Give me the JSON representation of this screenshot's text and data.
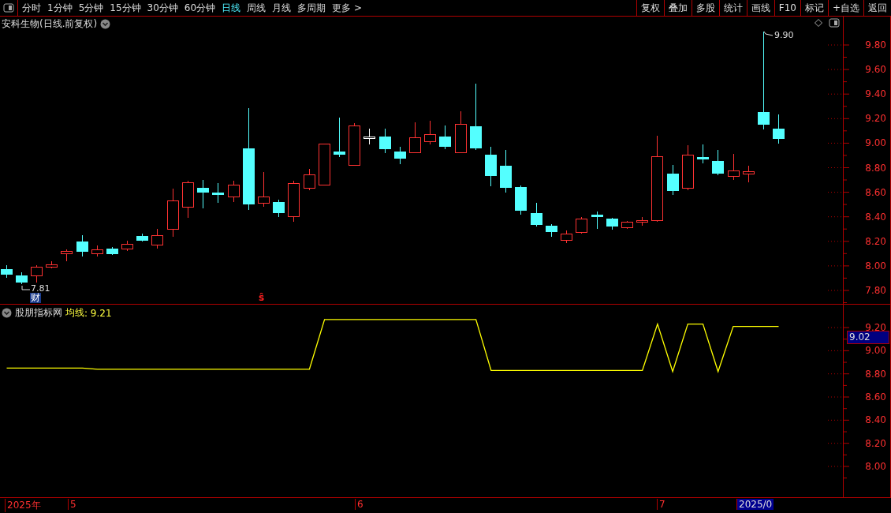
{
  "toolbar": {
    "tabs": [
      {
        "label": "分时",
        "selected": false
      },
      {
        "label": "1分钟",
        "selected": false
      },
      {
        "label": "5分钟",
        "selected": false
      },
      {
        "label": "15分钟",
        "selected": false
      },
      {
        "label": "30分钟",
        "selected": false
      },
      {
        "label": "60分钟",
        "selected": false
      },
      {
        "label": "日线",
        "selected": true
      },
      {
        "label": "周线",
        "selected": false
      },
      {
        "label": "月线",
        "selected": false
      },
      {
        "label": "多周期",
        "selected": false
      },
      {
        "label": "更多 >",
        "selected": false
      }
    ],
    "buttons": [
      "复权",
      "叠加",
      "多股",
      "统计",
      "画线",
      "F10",
      "标记",
      "+自选",
      "返回"
    ]
  },
  "price_chart": {
    "title": "安科生物(日线.前复权)",
    "axis_labels": [
      "9.80",
      "9.60",
      "9.40",
      "9.20",
      "9.00",
      "8.80",
      "8.60",
      "8.40",
      "8.20",
      "8.00",
      "7.80"
    ],
    "high_label": "9.90",
    "low_label": "7.81",
    "markers": [
      {
        "kind": "finance",
        "text": "财"
      },
      {
        "kind": "event",
        "text": "ŝ"
      }
    ]
  },
  "indicator": {
    "name": "股朋指标网",
    "line_name": "均线",
    "line_value": ": 9.21",
    "cursor_value": "9.02",
    "axis_labels": [
      "9.20",
      "9.00",
      "8.80",
      "8.60",
      "8.40",
      "8.20",
      "8.00"
    ]
  },
  "date_axis": {
    "labels": [
      {
        "text": "2025年",
        "selected": false
      },
      {
        "text": "5",
        "selected": false
      },
      {
        "text": "6",
        "selected": false
      },
      {
        "text": "7",
        "selected": false
      },
      {
        "text": "2025/0",
        "selected": true
      }
    ]
  }
}
